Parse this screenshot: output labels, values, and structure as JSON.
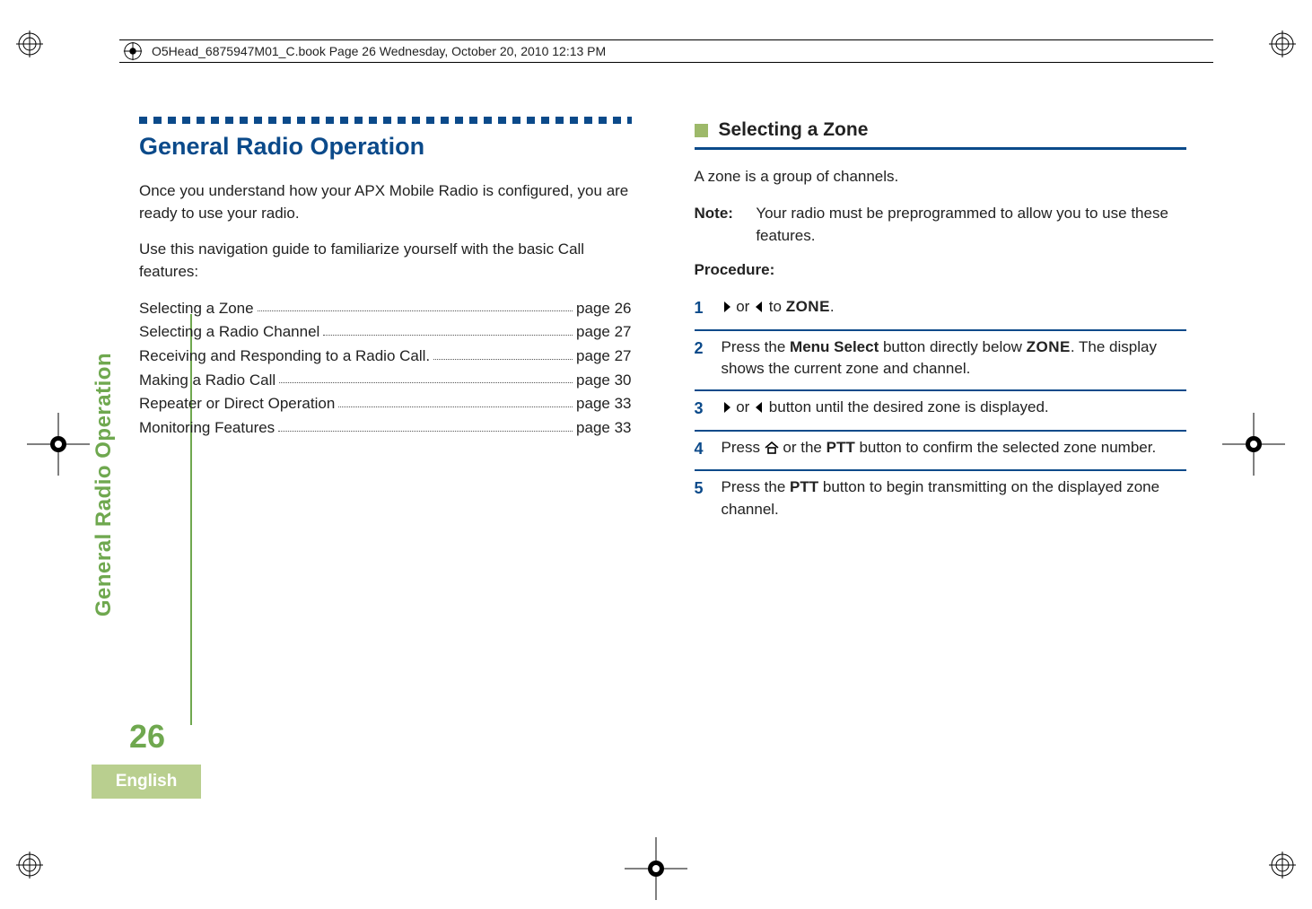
{
  "print_header": {
    "text": "O5Head_6875947M01_C.book  Page 26  Wednesday, October 20, 2010  12:13 PM"
  },
  "side_tab": {
    "label": "General Radio Operation",
    "page_number": "26",
    "language": "English"
  },
  "left_column": {
    "section_title": "General Radio Operation",
    "intro_1": "Once you understand how your APX Mobile Radio is configured, you are ready to use your radio.",
    "intro_2": "Use this navigation guide to familiarize yourself with the basic Call features:",
    "toc": [
      {
        "label": "Selecting a Zone",
        "page": "page 26"
      },
      {
        "label": "Selecting a Radio Channel",
        "page": "page 27"
      },
      {
        "label": "Receiving and Responding to a Radio Call.",
        "page": "page 27"
      },
      {
        "label": "Making a Radio Call",
        "page": "page 30"
      },
      {
        "label": "Repeater or Direct Operation",
        "page": "page 33"
      },
      {
        "label": "Monitoring Features",
        "page": "page 33"
      }
    ]
  },
  "right_column": {
    "subheading": "Selecting a Zone",
    "definition": "A zone is a group of channels.",
    "note_label": "Note:",
    "note_text": "Your radio must be preprogrammed to allow you to use these features.",
    "procedure_label": "Procedure:",
    "step1": {
      "num": "1",
      "pre": "",
      "mid_or": " or ",
      "post_to": " to ",
      "zone": "ZONE",
      "tail": "."
    },
    "step2": {
      "num": "2",
      "a": "Press the ",
      "b": "Menu Select",
      "c": " button directly below ",
      "zone": "ZONE",
      "d": ". The display shows the current zone and channel."
    },
    "step3": {
      "num": "3",
      "mid_or": " or ",
      "tail": " button until the desired zone is displayed."
    },
    "step4": {
      "num": "4",
      "a": "Press ",
      "b": " or the ",
      "ptt": "PTT",
      "c": " button to confirm the selected zone number."
    },
    "step5": {
      "num": "5",
      "a": "Press the ",
      "ptt": "PTT",
      "b": " button to begin transmitting on the displayed zone channel."
    }
  }
}
